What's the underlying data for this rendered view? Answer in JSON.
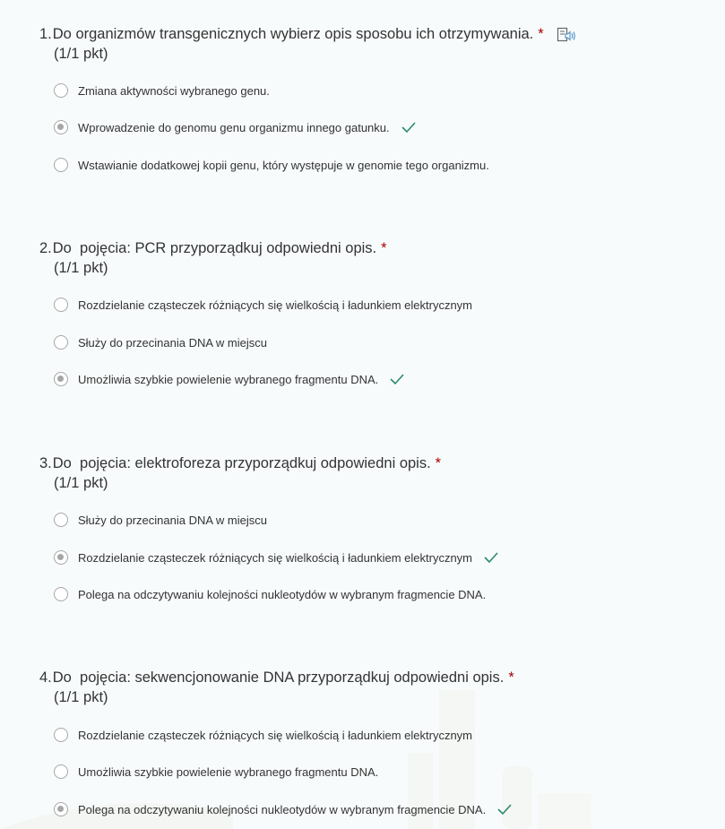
{
  "colors": {
    "background": "#f8fbfc",
    "required": "#a80000",
    "check": "#2b8a6e",
    "radio": "#a6a6a6"
  },
  "questions": [
    {
      "number": "1.",
      "text": "Do organizmów transgenicznych wybierz opis sposobu ich otrzymywania.",
      "required_mark": "*",
      "points": "(1/1 pkt)",
      "has_immersive_reader": true,
      "options": [
        {
          "label": "Zmiana aktywności wybranego genu.",
          "selected": false,
          "correct": false
        },
        {
          "label": "Wprowadzenie do genomu genu organizmu innego gatunku.",
          "selected": true,
          "correct": true
        },
        {
          "label": "Wstawianie dodatkowej kopii genu, który występuje w genomie tego organizmu.",
          "selected": false,
          "correct": false
        }
      ]
    },
    {
      "number": "2.",
      "text": "Do  pojęcia: PCR przyporządkuj odpowiedni opis.",
      "required_mark": "*",
      "points": "(1/1 pkt)",
      "has_immersive_reader": false,
      "options": [
        {
          "label": "Rozdzielanie cząsteczek różniących się wielkością i ładunkiem elektrycznym",
          "selected": false,
          "correct": false
        },
        {
          "label": "Służy do przecinania DNA w miejscu",
          "selected": false,
          "correct": false
        },
        {
          "label": "Umożliwia szybkie powielenie wybranego fragmentu DNA.",
          "selected": true,
          "correct": true
        }
      ]
    },
    {
      "number": "3.",
      "text": "Do  pojęcia: elektroforeza przyporządkuj odpowiedni opis.",
      "required_mark": "*",
      "points": "(1/1 pkt)",
      "has_immersive_reader": false,
      "options": [
        {
          "label": "Służy do przecinania DNA w miejscu",
          "selected": false,
          "correct": false
        },
        {
          "label": "Rozdzielanie cząsteczek różniących się wielkością i ładunkiem elektrycznym",
          "selected": true,
          "correct": true
        },
        {
          "label": "Polega na odczytywaniu kolejności nukleotydów w wybranym fragmencie DNA.",
          "selected": false,
          "correct": false
        }
      ]
    },
    {
      "number": "4.",
      "text": "Do  pojęcia: sekwencjonowanie DNA przyporządkuj odpowiedni opis.",
      "required_mark": "*",
      "points": "(1/1 pkt)",
      "has_immersive_reader": false,
      "options": [
        {
          "label": "Rozdzielanie cząsteczek różniących się wielkością i ładunkiem elektrycznym",
          "selected": false,
          "correct": false
        },
        {
          "label": "Umożliwia szybkie powielenie wybranego fragmentu DNA.",
          "selected": false,
          "correct": false
        },
        {
          "label": "Polega na odczytywaniu kolejności nukleotydów w wybranym fragmencie DNA.",
          "selected": true,
          "correct": true
        }
      ]
    }
  ]
}
